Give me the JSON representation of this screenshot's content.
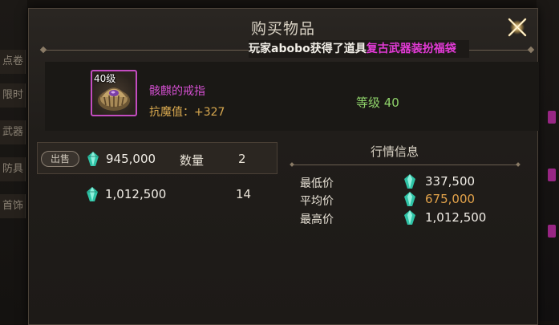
{
  "side_tabs": [
    "点卷",
    "限时",
    "武器",
    "防具",
    "首饰"
  ],
  "dialog": {
    "title": "购买物品",
    "marquee": {
      "text": "玩家abobo获得了道具",
      "highlight": "复古武器装扮福袋"
    }
  },
  "item": {
    "level_badge": "40级",
    "name": "骸麒的戒指",
    "stat": "抗魔值：+327",
    "grade": "等级 40",
    "border_color": "#c34cc0"
  },
  "listings": [
    {
      "tag": "出售",
      "price": "945,000",
      "qty_label": "数量",
      "qty": "2",
      "selected": true
    },
    {
      "tag": "",
      "price": "1,012,500",
      "qty_label": "",
      "qty": "14",
      "selected": false
    }
  ],
  "market": {
    "title": "行情信息",
    "rows": [
      {
        "label": "最低价",
        "value": "337,500"
      },
      {
        "label": "平均价",
        "value": "675,000"
      },
      {
        "label": "最高价",
        "value": "1,012,500"
      }
    ]
  },
  "colors": {
    "item_name": "#d34fd0",
    "stat": "#d8a84f",
    "grade": "#8fd36a",
    "avg_price": "#e2a24a",
    "marquee_highlight": "#e23ad6"
  },
  "icons": {
    "currency": "crystal-gem-icon",
    "close": "close-icon"
  }
}
